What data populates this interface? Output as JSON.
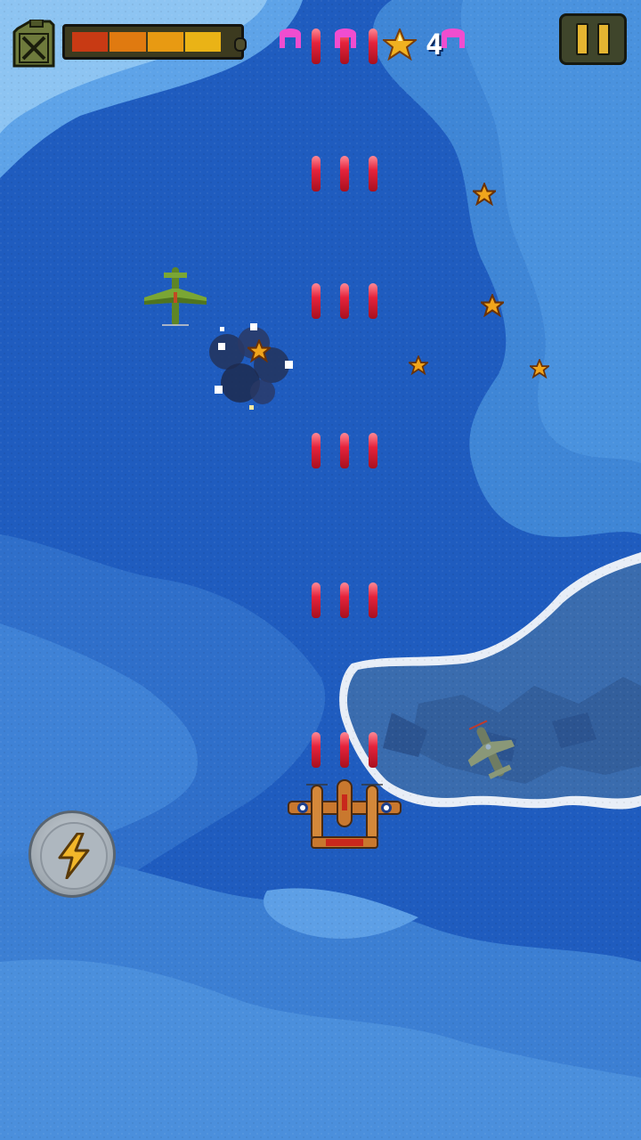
{
  "hud": {
    "fuel_level": 0.9,
    "fuel_segment_colors": [
      "#c83a14",
      "#e07a10",
      "#e89a12",
      "#eab316"
    ],
    "star_count": "4",
    "pause_icon": "pause-icon",
    "power_icon": "lightning-bolt-icon"
  },
  "colors": {
    "sky": "#1d5bbd",
    "cloud": "#4e93df",
    "island": "#3a6fb0",
    "bullet": "#e5233c",
    "star": "#f0a51c",
    "enemy_green": "#6f9a2d",
    "player_plane": "#c9782e"
  }
}
